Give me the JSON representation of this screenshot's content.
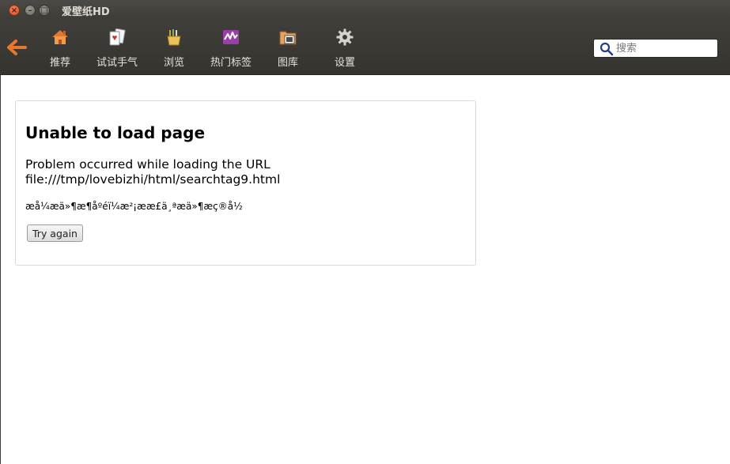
{
  "window": {
    "title": "爱壁纸HD",
    "close_glyph": "×",
    "min_glyph": "–",
    "max_glyph": "□"
  },
  "toolbar": {
    "back_icon": "arrow-left-icon",
    "items": [
      {
        "label": "推荐",
        "icon": "home-icon"
      },
      {
        "label": "试试手气",
        "icon": "playing-cards-icon"
      },
      {
        "label": "浏览",
        "icon": "brush-cup-icon"
      },
      {
        "label": "热门标签",
        "icon": "chart-wave-icon"
      },
      {
        "label": "图库",
        "icon": "gallery-folder-icon"
      },
      {
        "label": "设置",
        "icon": "gear-icon"
      }
    ]
  },
  "search": {
    "placeholder": "搜索",
    "value": ""
  },
  "error": {
    "title": "Unable to load page",
    "message_line1": "Problem occurred while loading the URL",
    "message_line2": "file:///tmp/lovebizhi/html/searchtag9.html",
    "garbled": "æå¼æä»¶æ¶åºéï¼æ²¡ææ£ä¸ªæä»¶æç®å½",
    "button": "Try again"
  },
  "colors": {
    "titlebar": "#3d3c38",
    "toolbar": "#3a3935",
    "accent_orange": "#e8762c"
  }
}
